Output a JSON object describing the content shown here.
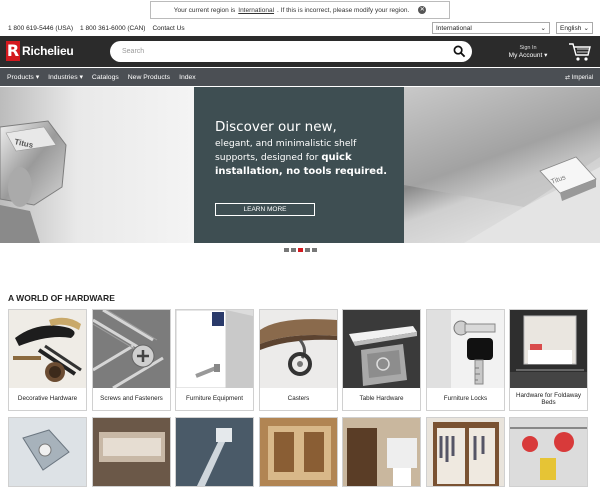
{
  "region_notice": {
    "before": "Your current region is",
    "region": "International",
    "after": ". If this is incorrect, please modify your region."
  },
  "topbar": {
    "phone_usa": "1 800 619-5446 (USA)",
    "phone_can": "1 800 361-6000 (CAN)",
    "contact": "Contact Us",
    "region_select": "International",
    "language_select": "English"
  },
  "header": {
    "logo_text": "Richelieu",
    "search_placeholder": "Search",
    "sign_in": "Sign In",
    "my_account": "My Account"
  },
  "nav": {
    "items": [
      "Products",
      "Industries",
      "Catalogs",
      "New Products",
      "Index"
    ],
    "units": "Imperial"
  },
  "hero": {
    "headline": "Discover our new,",
    "line1": "elegant, and minimalistic shelf",
    "line2_a": "supports, designed for",
    "line2_b": "quick",
    "line3": "installation, no tools required.",
    "cta": "LEARN MORE",
    "product_mark": "Titus",
    "slide_count": 5,
    "active_slide": 3
  },
  "section": {
    "title": "A WORLD OF HARDWARE",
    "categories": [
      "Decorative Hardware",
      "Screws and Fasteners",
      "Furniture Equipment",
      "Casters",
      "Table Hardware",
      "Furniture Locks",
      "Hardware for Foldaway Beds"
    ]
  },
  "colors": {
    "brand_red": "#d3191f",
    "header_bg": "#2b2b2b",
    "nav_bg": "#4b4f54",
    "hero_panel": "#3e4e52"
  }
}
